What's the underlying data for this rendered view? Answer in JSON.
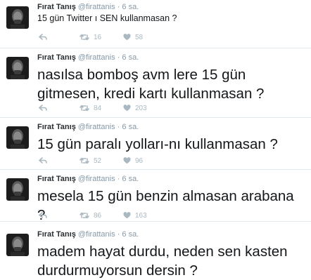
{
  "tweets": [
    {
      "name": "Fırat Tanış",
      "handle": "@firattanis",
      "dot": "·",
      "time": "6 sa.",
      "text": "15 gün Twitter ı SEN kullanmasan ?",
      "retweets": "16",
      "likes": "58"
    },
    {
      "name": "Fırat Tanış",
      "handle": "@firattanis",
      "dot": "·",
      "time": "6 sa.",
      "text": "nasılsa bomboş avm lere 15 gün gitmesen, kredi kartı kullanmasan ?",
      "retweets": "84",
      "likes": "203"
    },
    {
      "name": "Fırat Tanış",
      "handle": "@firattanis",
      "dot": "·",
      "time": "6 sa.",
      "text": "15 gün paralı yolları-nı kullanmasan ?",
      "retweets": "52",
      "likes": "96"
    },
    {
      "name": "Fırat Tanış",
      "handle": "@firattanis",
      "dot": "·",
      "time": "6 sa.",
      "text": "mesela 15 gün benzin almasan arabana ?",
      "retweets": "86",
      "likes": "163"
    },
    {
      "name": "Fırat Tanış",
      "handle": "@firattanis",
      "dot": "·",
      "time": "6 sa.",
      "text": "madem hayat durdu, neden sen kasten durdurmuyorsun dersin ?"
    }
  ],
  "icons": {
    "reply": "reply-icon",
    "retweet": "retweet-icon",
    "like": "heart-icon"
  },
  "colors": {
    "action_gray": "#aab8c2",
    "meta_gray": "#8899a6",
    "divider": "#e1e8ed"
  }
}
